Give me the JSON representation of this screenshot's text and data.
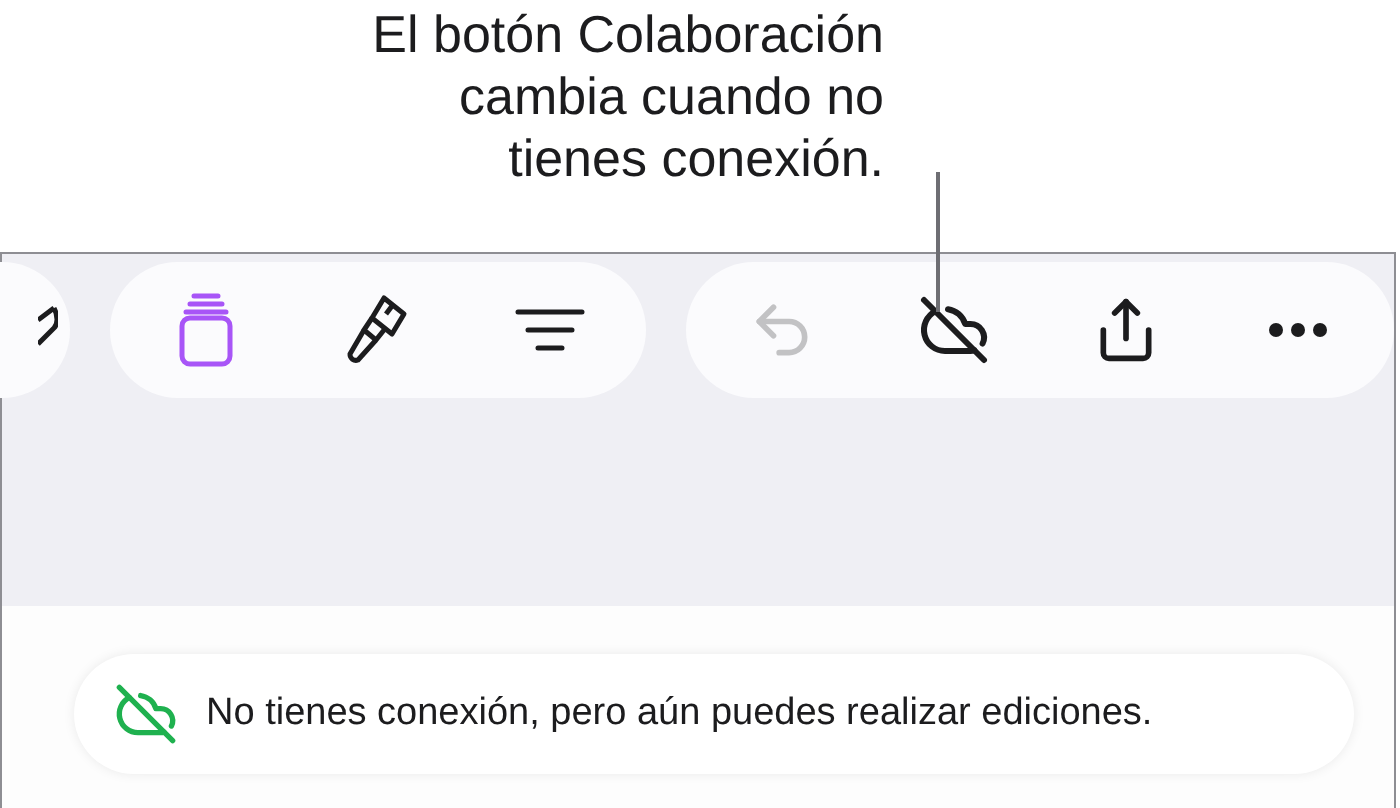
{
  "callout": {
    "lines": [
      "El botón Colaboración",
      "cambia cuando no",
      "tienes conexión."
    ]
  },
  "toolbar_groups": [
    {
      "partial": true,
      "buttons": [
        {
          "kind": "partial",
          "active": false,
          "disabled": false
        }
      ]
    },
    {
      "partial": false,
      "buttons": [
        {
          "kind": "document",
          "active": true,
          "disabled": false
        },
        {
          "kind": "brush",
          "active": false,
          "disabled": false
        },
        {
          "kind": "align",
          "active": false,
          "disabled": false
        }
      ]
    },
    {
      "partial": false,
      "buttons": [
        {
          "kind": "undo",
          "active": false,
          "disabled": true
        },
        {
          "kind": "cloud-off",
          "active": false,
          "disabled": false
        },
        {
          "kind": "share",
          "active": false,
          "disabled": false
        },
        {
          "kind": "more",
          "active": false,
          "disabled": false
        }
      ]
    }
  ],
  "banner": {
    "text": "No tienes conexión, pero aún puedes realizar ediciones."
  }
}
